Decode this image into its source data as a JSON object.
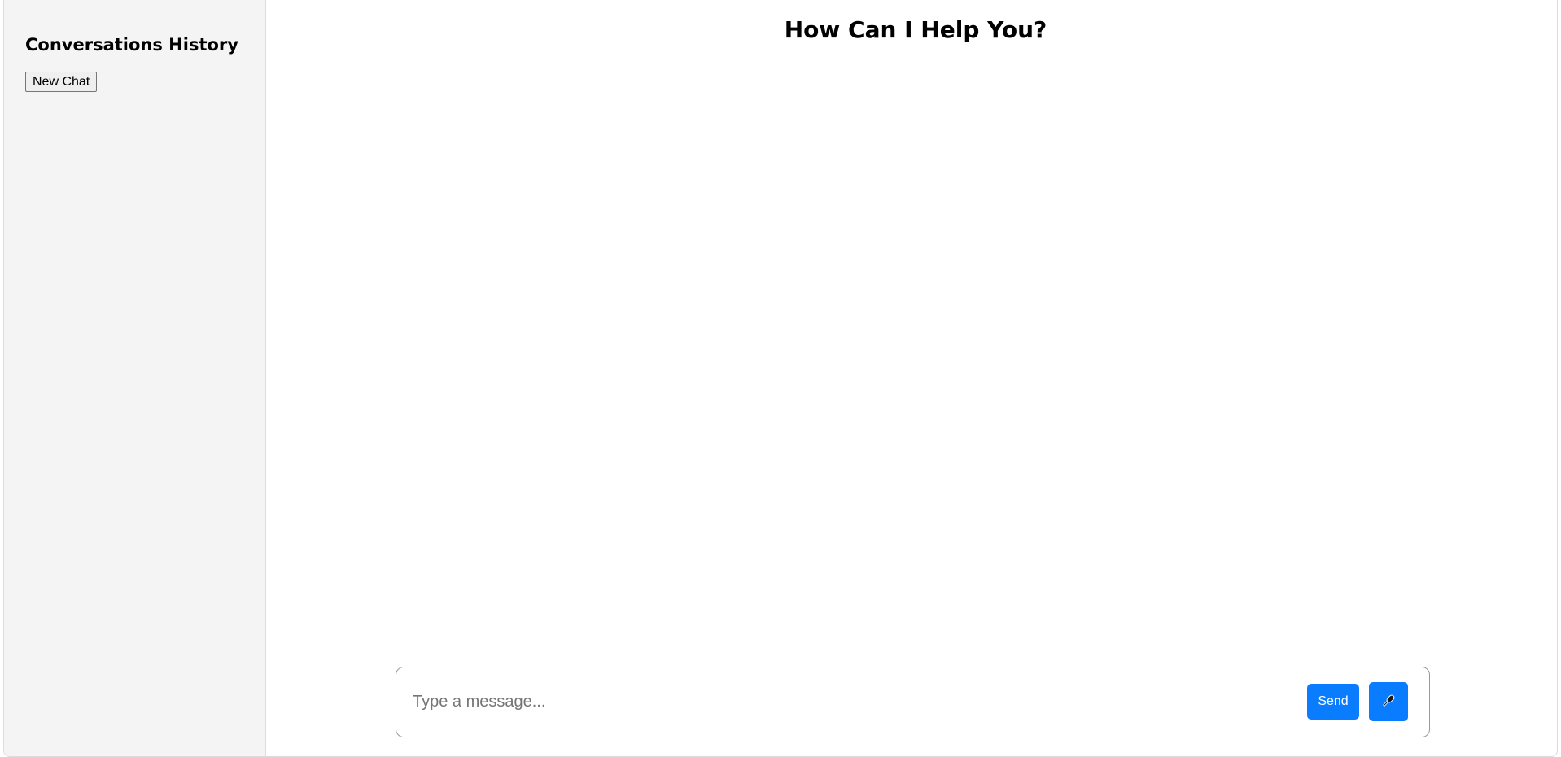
{
  "sidebar": {
    "title": "Conversations History",
    "new_chat_label": "New Chat"
  },
  "main": {
    "title": "How Can I Help You?"
  },
  "composer": {
    "placeholder": "Type a message...",
    "value": "",
    "send_label": "Send",
    "mic_icon": "microphone-icon"
  },
  "colors": {
    "accent": "#0a7cff",
    "sidebar_bg": "#f4f4f4"
  }
}
